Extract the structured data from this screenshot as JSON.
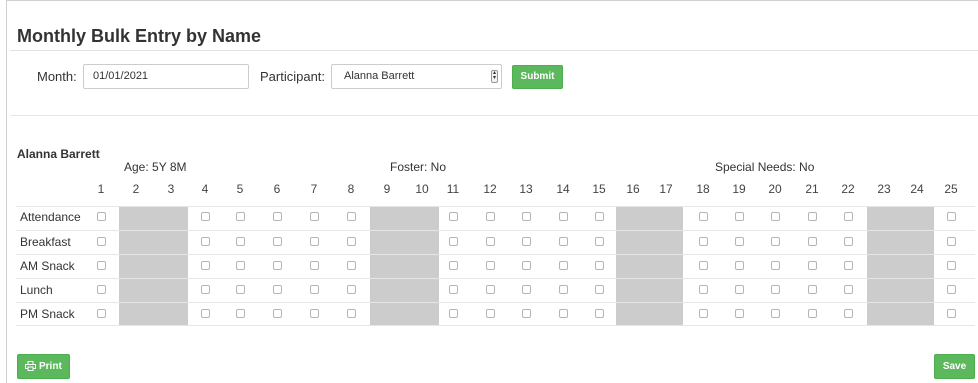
{
  "page": {
    "title": "Monthly Bulk Entry by Name"
  },
  "filters": {
    "month_label": "Month:",
    "month_value": "01/01/2021",
    "participant_label": "Participant:",
    "participant_value": "Alanna Barrett",
    "submit_label": "Submit"
  },
  "participant": {
    "name": "Alanna Barrett",
    "age": "Age: 5Y 8M",
    "foster": "Foster: No",
    "special_needs": "Special Needs: No"
  },
  "grid": {
    "days": [
      "1",
      "2",
      "3",
      "4",
      "5",
      "6",
      "7",
      "8",
      "9",
      "10",
      "11",
      "12",
      "13",
      "14",
      "15",
      "16",
      "17",
      "18",
      "19",
      "20",
      "21",
      "22",
      "23",
      "24",
      "25"
    ],
    "disabled_days": [
      "2",
      "3",
      "9",
      "10",
      "16",
      "17",
      "23",
      "24"
    ],
    "rows": [
      "Attendance",
      "Breakfast",
      "AM Snack",
      "Lunch",
      "PM Snack"
    ]
  },
  "footer": {
    "print_label": "Print",
    "save_label": "Save"
  },
  "colors": {
    "accent": "#5cb85c",
    "disabled_cell": "#cccccc"
  },
  "icons": {
    "print": "printer-icon"
  }
}
